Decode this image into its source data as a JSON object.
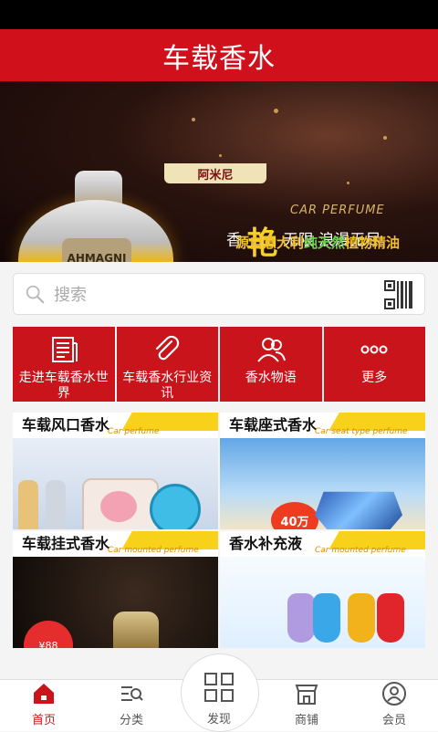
{
  "header": {
    "title": "车载香水"
  },
  "banner": {
    "brand_tag": "阿米尼",
    "bottle_label": "AHMAGNI",
    "en_line": "CAR PERFUME",
    "line1_prefix": "香",
    "line1_big": "艳",
    "line1_suffix": "无限  浪漫无尽",
    "line2_part1": "源自意大利",
    "line2_green": "纯天然",
    "line2_part2": "植物精油",
    "slide_count": 6,
    "active_slide": 1
  },
  "search": {
    "placeholder": "搜索"
  },
  "categories": [
    {
      "label": "走进车载香水世界",
      "icon": "newspaper-icon"
    },
    {
      "label": "车载香水行业资讯",
      "icon": "paperclip-icon"
    },
    {
      "label": "香水物语",
      "icon": "users-icon"
    },
    {
      "label": "更多",
      "icon": "more-dots-icon"
    }
  ],
  "tiles": [
    {
      "title": "车载风口香水",
      "subtitle": "Car perfume"
    },
    {
      "title": "车载座式香水",
      "subtitle": "Car seat type perfume",
      "promo": "40万"
    },
    {
      "title": "车载挂式香水",
      "subtitle": "Car mounted perfume",
      "promo": "¥88"
    },
    {
      "title": "香水补充液",
      "subtitle": "Car mounted perfume"
    }
  ],
  "bottom_nav": [
    {
      "label": "首页",
      "icon": "home-icon",
      "active": true
    },
    {
      "label": "分类",
      "icon": "category-search-icon",
      "active": false
    },
    {
      "label": "发现",
      "icon": "grid-icon",
      "active": false
    },
    {
      "label": "商铺",
      "icon": "shop-icon",
      "active": false
    },
    {
      "label": "会员",
      "icon": "user-icon",
      "active": false
    }
  ],
  "colors": {
    "brand_red": "#d0101a",
    "status_black": "#000000",
    "yellow_stripe": "#f7d11a"
  }
}
